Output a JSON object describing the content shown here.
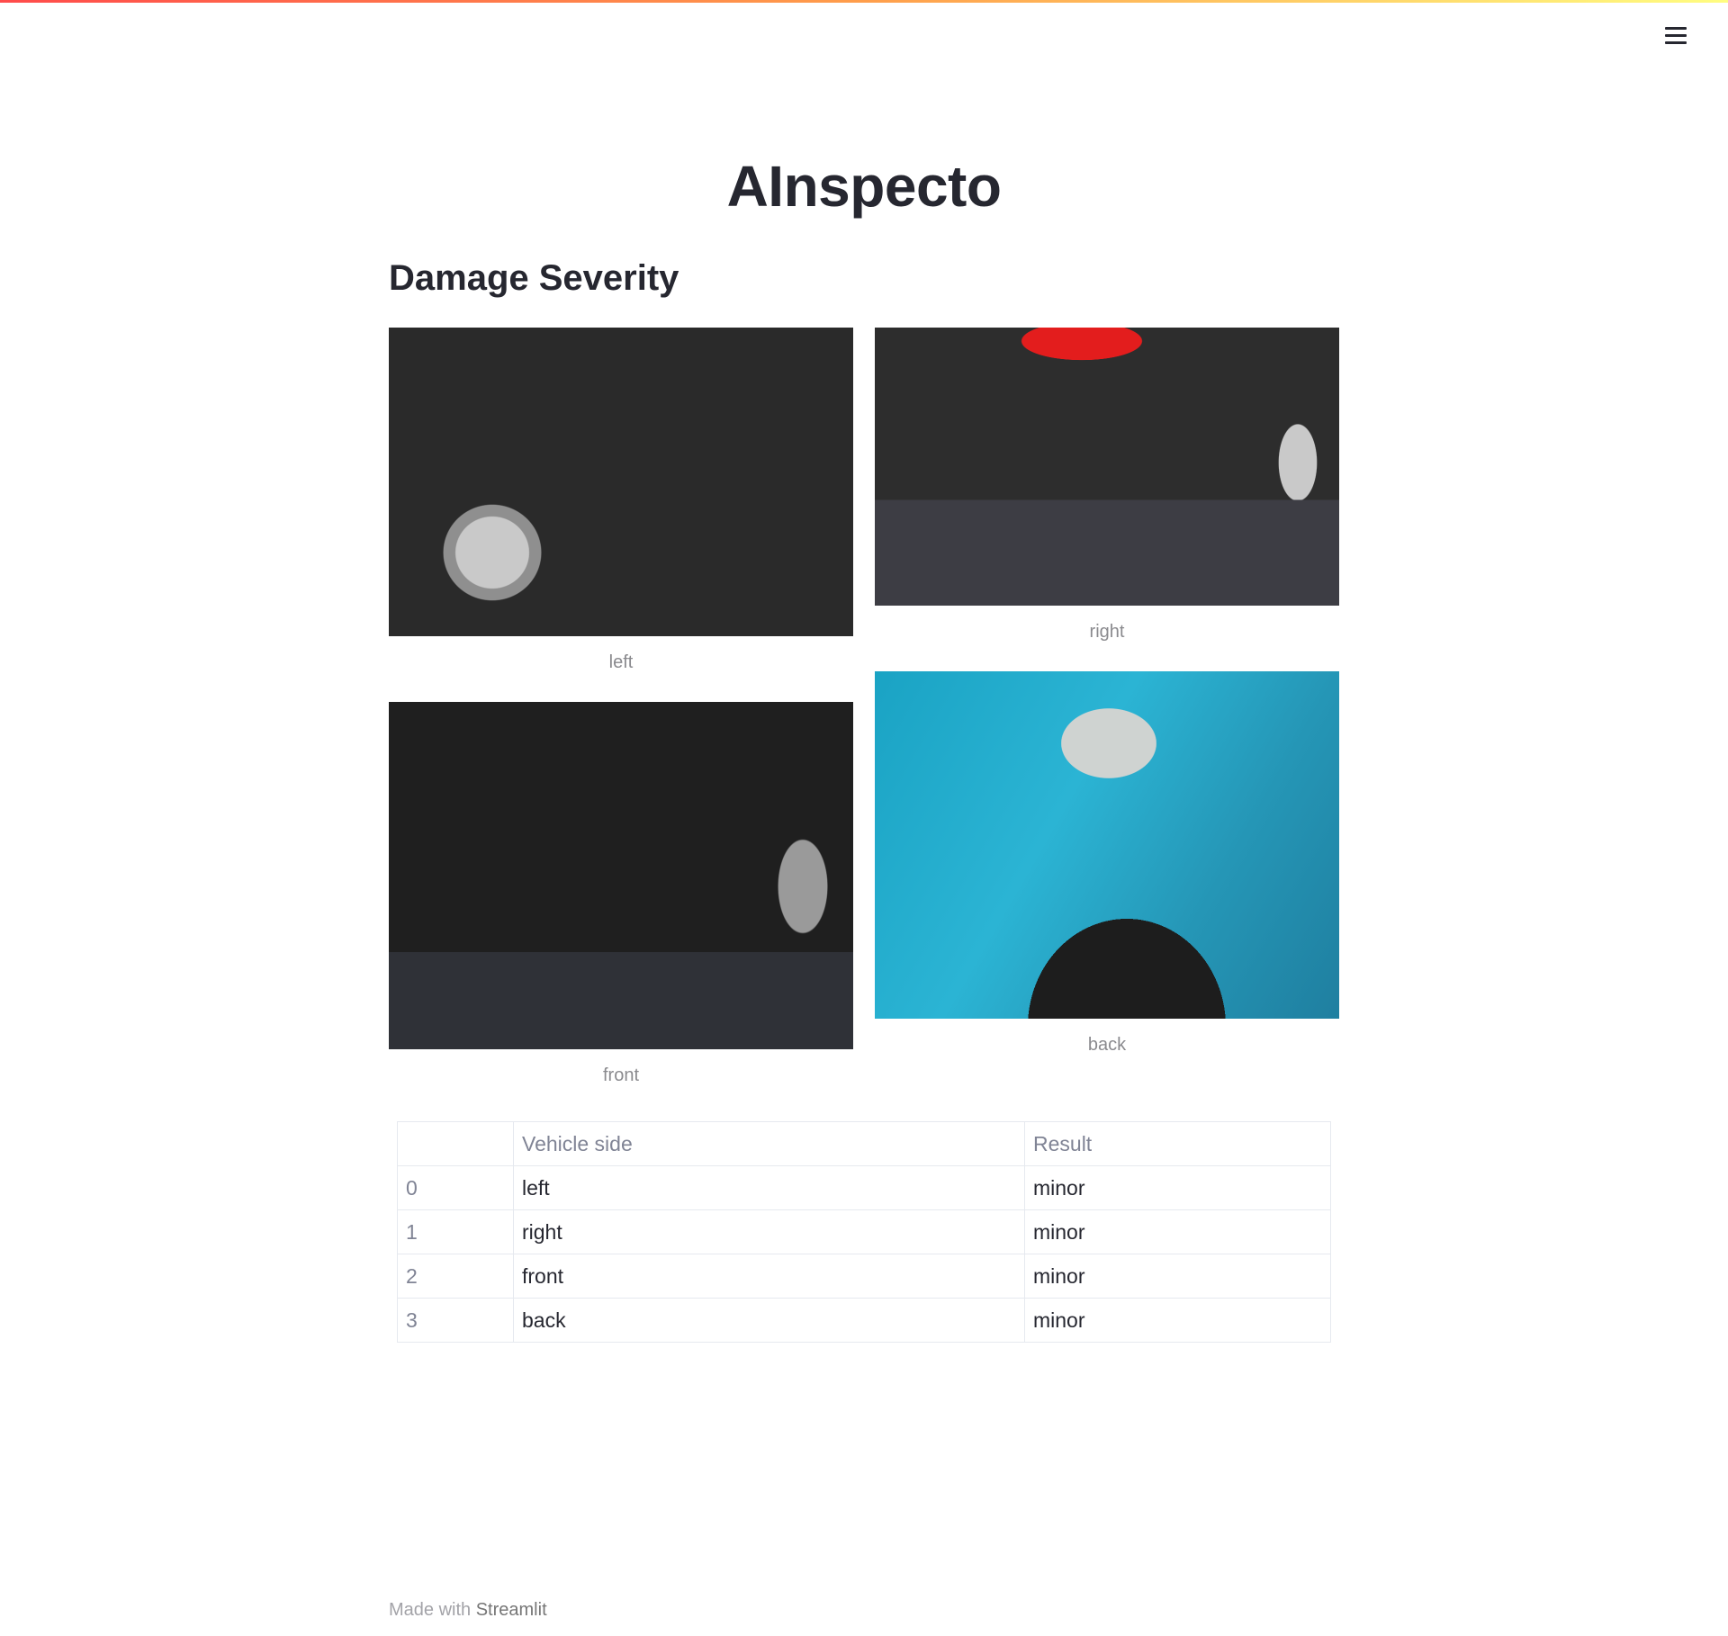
{
  "header": {
    "menu_icon": "hamburger-menu-icon"
  },
  "app": {
    "title": "AInspecto"
  },
  "section": {
    "title": "Damage Severity"
  },
  "images": [
    {
      "caption": "left",
      "description_icon": "car-photo"
    },
    {
      "caption": "right",
      "description_icon": "car-photo"
    },
    {
      "caption": "front",
      "description_icon": "car-photo"
    },
    {
      "caption": "back",
      "description_icon": "car-photo"
    }
  ],
  "table": {
    "columns": [
      "",
      "Vehicle side",
      "Result"
    ],
    "rows": [
      {
        "index": "0",
        "side": "left",
        "result": "minor"
      },
      {
        "index": "1",
        "side": "right",
        "result": "minor"
      },
      {
        "index": "2",
        "side": "front",
        "result": "minor"
      },
      {
        "index": "3",
        "side": "back",
        "result": "minor"
      }
    ]
  },
  "footer": {
    "prefix": "Made with",
    "link": "Streamlit"
  },
  "colors": {
    "text": "#262730",
    "caption": "#8a8a8e",
    "table_border": "#e6e9ef",
    "decoration_start": "#ff4b4b",
    "decoration_end": "#fffd80"
  }
}
